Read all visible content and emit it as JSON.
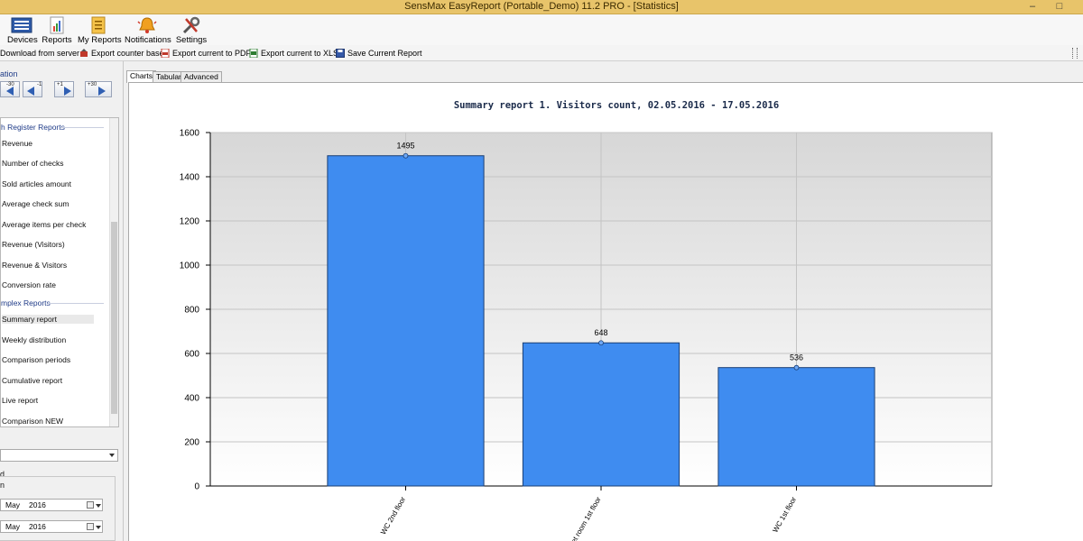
{
  "window": {
    "title": "SensMax EasyReport (Portable_Demo) 11.2 PRO - [Statistics]",
    "min_label": "–",
    "max_label": "□"
  },
  "ribbon": {
    "items": [
      {
        "label": "Devices",
        "icon": "devices-icon"
      },
      {
        "label": "Reports",
        "icon": "reports-icon"
      },
      {
        "label": "My Reports",
        "icon": "my-reports-icon"
      },
      {
        "label": "Notifications",
        "icon": "notifications-icon"
      },
      {
        "label": "Settings",
        "icon": "settings-icon"
      }
    ]
  },
  "toolbar": {
    "items": [
      {
        "label": "Download from server"
      },
      {
        "label": "Export counter base"
      },
      {
        "label": "Export current to PDF"
      },
      {
        "label": "Export current to XLS"
      },
      {
        "label": "Save Current Report"
      }
    ]
  },
  "left_panel": {
    "navigation_header": "ation",
    "nav_buttons": [
      "-30",
      "-1",
      "+1",
      "+30"
    ],
    "cash_register_header": "h Register Reports",
    "cash_register_items": [
      "Revenue",
      "Number of checks",
      "Sold articles amount",
      "Average check sum",
      "Average items per check",
      "Revenue (Visitors)",
      "Revenue & Visitors",
      "Conversion rate"
    ],
    "complex_header": "mplex Reports",
    "complex_items": [
      "Summary report",
      "Weekly distribution",
      "Comparison periods",
      "Cumulative report",
      "Live report",
      "Comparison NEW"
    ],
    "period_header": "d",
    "from_label": "n",
    "date_from": {
      "month": "May",
      "year": "2016"
    },
    "date_to": {
      "month": "May",
      "year": "2016"
    }
  },
  "tabs": [
    {
      "label": "Charts",
      "active": true
    },
    {
      "label": "Tabular",
      "active": false
    },
    {
      "label": "Advanced",
      "active": false
    }
  ],
  "chart_data": {
    "type": "bar",
    "title": "Summary report 1. Visitors count, 02.05.2016 - 17.05.2016",
    "categories": [
      "WC 2nd floor",
      "Toilet room 1st floor",
      "WC 1st floor"
    ],
    "values": [
      1495,
      648,
      536
    ],
    "data_labels": [
      "1495",
      "648",
      "536"
    ],
    "ylim": [
      0,
      1600
    ],
    "yticks": [
      0,
      200,
      400,
      600,
      800,
      1000,
      1200,
      1400,
      1600
    ],
    "grid": true,
    "colors": {
      "bar": "#3f8cf0",
      "bar_edge": "#1a3f75",
      "plot_bg_top": "#d7d7d7",
      "plot_bg_bottom": "#ffffff",
      "grid": "#c4c4c4"
    }
  }
}
